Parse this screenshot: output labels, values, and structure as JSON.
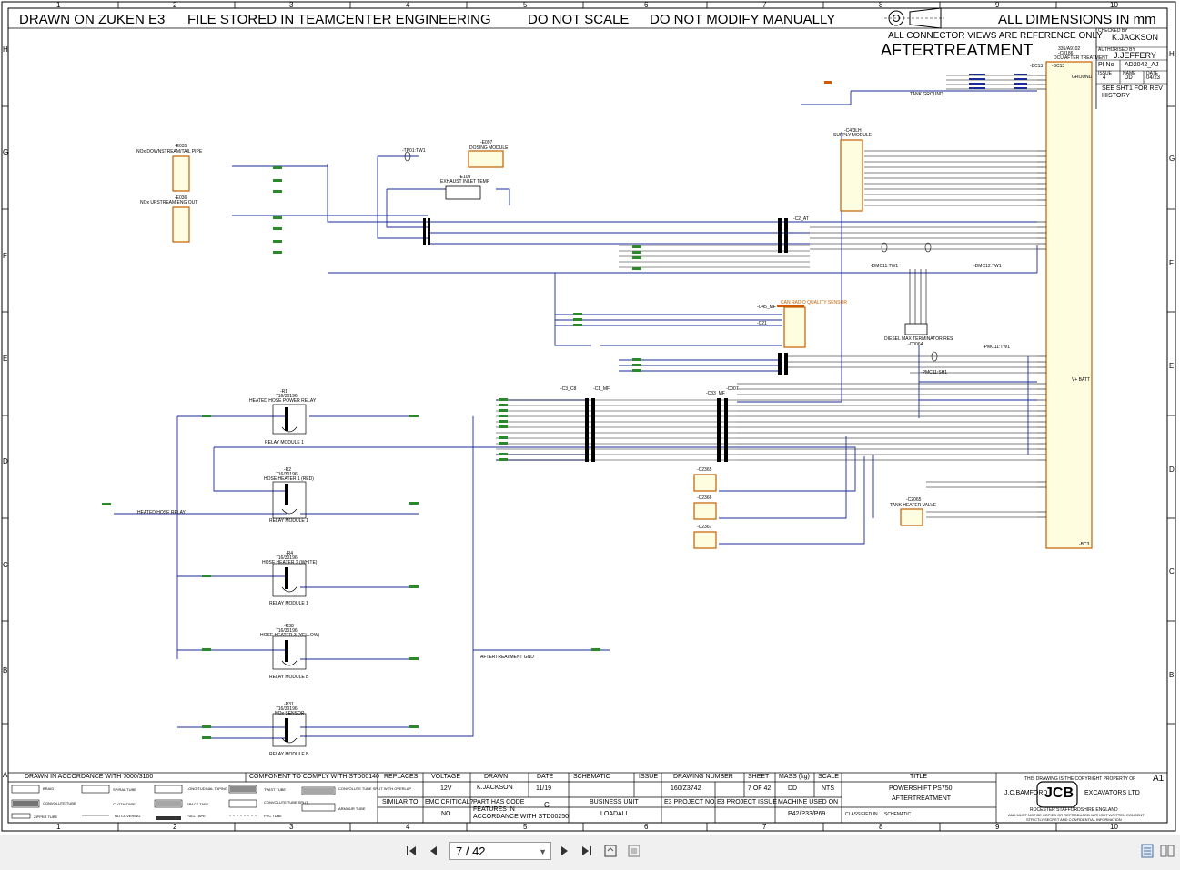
{
  "header": {
    "drawn_on": "DRAWN ON ZUKEN E3",
    "file_stored": "FILE STORED IN TEAMCENTER ENGINEERING",
    "do_not_scale": "DO NOT SCALE",
    "do_not_modify": "DO NOT MODIFY MANUALLY",
    "dimensions": "ALL DIMENSIONS IN mm",
    "connector_note": "ALL CONNECTOR VIEWS ARE REFERENCE ONLY",
    "title": "AFTERTREATMENT"
  },
  "side_box": {
    "checked_by_label": "CHECKED BY",
    "checked_by": "K.JACKSON",
    "authorised_by_label": "AUTHORISED BY",
    "authorised_by": "J.JEFFERY",
    "pi_no_label": "PI No",
    "pi_no": "AD2042_AJ",
    "issue_label": "ISSUE",
    "name_label": "NAME",
    "date_label": "DATE",
    "issue": "4",
    "name": "DD",
    "date": "04/23",
    "rev_note_1": "SEE SHT1 FOR REV",
    "rev_note_2": "HISTORY"
  },
  "grid": {
    "columns": [
      "1",
      "2",
      "3",
      "4",
      "5",
      "6",
      "7",
      "8",
      "9",
      "10"
    ],
    "rows": [
      "H",
      "G",
      "F",
      "E",
      "D",
      "C",
      "B",
      "A"
    ]
  },
  "components": {
    "ecu_name": "DCU AFTER TREATMENT",
    "ecu_code": "-C8186",
    "ecu_part": "335/A9102",
    "ecu_conn_top": "-BC13",
    "ecu_conn_bottom": "-BC3",
    "ground": "GROUND",
    "vbatt": "V+ BATT",
    "supply_module": "SUPPLY MODULE",
    "supply_module_ref": "-C4/3LH",
    "dosing_module": "DOSING MODULE",
    "dosing_ref": "-E097",
    "exhaust_temp": "EXHAUST INLET TEMP",
    "exhaust_ref": "-E109",
    "nox_down": "NOx DOWNSTREAM/TAIL PIPE",
    "nox_down_ref": "-E035",
    "nox_up": "NOx UPSTREAM ENG OUT",
    "nox_up_ref": "-E036",
    "can_sensor": "CAN RADIO QUALITY SENSOR",
    "can_sensor_ref": "-C45_MF",
    "terminator": "DIESEL MAX TERMINATOR RES",
    "terminator_ref": "-C0064",
    "tank_heater": "TANK HEATER VALVE",
    "tank_heater_ref": "-C2065",
    "tank_ground": "TANK GROUND",
    "hose_power_relay": "HEATED HOSE POWER RELAY",
    "hose_power_ref": "-R1",
    "relay_module_1": "RELAY MODULE 1",
    "hose_heater_1": "HOSE HEATER 1 (RED)",
    "hose_heater_1_ref": "-R2",
    "hose_heater_2": "HOSE HEATER 2 (WHITE)",
    "hose_heater_2_ref": "-R4",
    "hose_heater_3": "HOSE HEATER 3 (YELLOW)",
    "hose_heater_3_ref": "-R38",
    "relay_module_b": "RELAY MODULE B",
    "nox_sensor": "NOx SENSOR",
    "nox_sensor_ref": "-R31",
    "relay_part": "716/30196",
    "heated_hose_relay": "HEATED HOSE RELAY",
    "aftertreatment_gnd": "AFTERTREATMENT GND",
    "connector_c1": "-C1_MF",
    "connector_c2": "-C2_AT",
    "connector_c3": "-C3_C8",
    "connector_c007": "-C007",
    "connector_c33": "-C33_MF",
    "c21": "-C21",
    "tw1": "-TP01:TW1",
    "dmc1": "-DMC11:TW1",
    "dmc2": "-DMC12:TW1",
    "pmc1": "-PMC11:TW1",
    "pmc2": "-PMC11:SH1",
    "c2365": "-C2365",
    "c2366": "-C2366",
    "c2367": "-C2367"
  },
  "title_block": {
    "drawn_std": "DRAWN IN ACCORDANCE WITH 7000/3100",
    "comply_std": "COMPONENT TO COMPLY WITH STD00140",
    "replaces_label": "REPLACES",
    "voltage_label": "VOLTAGE",
    "voltage": "12V",
    "drawn_label": "DRAWN",
    "drawn_by": "K.JACKSON",
    "date_label": "DATE",
    "date": "11/19",
    "schematic_label": "SCHEMATIC",
    "issue_label": "ISSUE",
    "drawing_number_label": "DRAWING NUMBER",
    "drawing_number": "160/Z3742",
    "sheet_label": "SHEET",
    "sheet": "7 OF 42",
    "mass_label": "MASS (kg)",
    "mass": "DD",
    "scale_label": "SCALE",
    "scale": "NTS",
    "title_label": "TITLE",
    "title_line1": "POWERSHIFT PS750",
    "title_line2": "AFTERTREATMENT",
    "similar_to_label": "SIMILAR TO",
    "emc_label": "EMC CRITICAL?",
    "emc": "NO",
    "part_code_1": "PART HAS CODE",
    "part_code_2": "FEATURES IN",
    "part_code_3": "ACCORDANCE WITH STD00250",
    "issue_letter": "C",
    "business_unit_label": "BUSINESS UNIT",
    "business_unit": "LOADALL",
    "e3_project_no": "E3 PROJECT NO.",
    "e3_project_issue": "E3 PROJECT ISSUE",
    "machine_used": "MACHINE USED ON",
    "machine": "P42/P33/P69",
    "classified_label": "CLASSIFIED IN",
    "classified": "SCHEMATIC",
    "copyright": "THIS DRAWING IS THE COPYRIGHT PROPERTY OF",
    "company_left": "J.C.BAMFORD",
    "company_right": "EXCAVATORS LTD",
    "address": "ROCESTER     STAFFORDSHIRE     ENGLAND",
    "disclaimer_1": "AND MUST NOT BE COPIED OR REPRODUCED WITHOUT WRITTEN CONSENT",
    "disclaimer_2": "STRICTLY SECRET AND CONFIDENTIAL INFORMATION",
    "sheet_size": "A1",
    "logo": "JCB"
  },
  "legend": {
    "braid": "BRAID",
    "spiral": "SPIRAL TUBE",
    "long_taping": "LONGITUDINAL TAPING",
    "twist": "TWIST TUBE",
    "convolute_overlap": "CONVOLUTE TUBE SPLIT WITH OVERLAP",
    "convolute": "CONVOLUTE TUBE",
    "cloth": "CLOTH TAPE",
    "space": "SPACE TAPE",
    "convolute_split": "CONVOLUTE TUBE SPLIT",
    "armour": "ARMOUR TUBE",
    "zipper": "ZIPPER TUBE",
    "no_covering": "NO COVERING",
    "full": "FULL TAPE",
    "pvc": "PVC TUBE"
  },
  "viewer": {
    "page_value": "7 / 42",
    "first_icon": "first-page-icon",
    "prev_icon": "prev-page-icon",
    "next_icon": "next-page-icon",
    "last_icon": "last-page-icon"
  }
}
